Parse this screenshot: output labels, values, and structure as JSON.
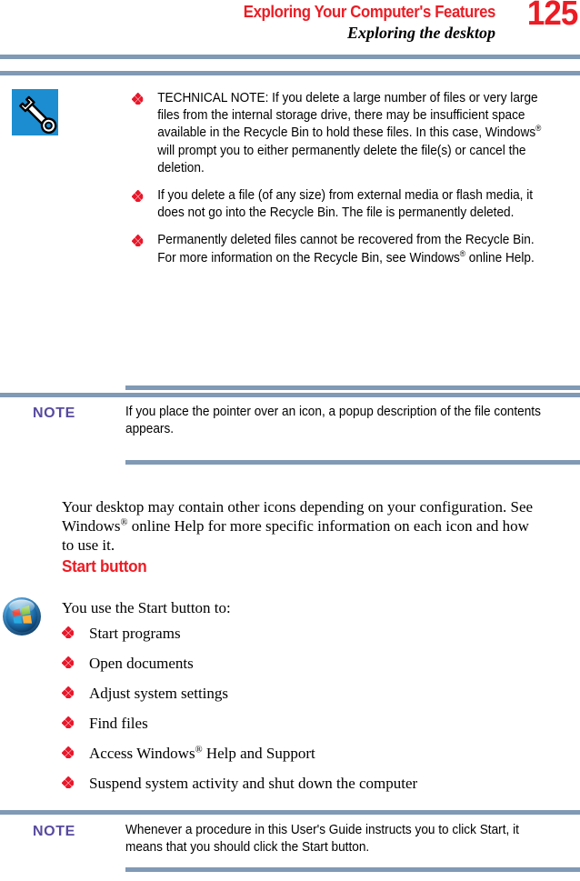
{
  "header": {
    "chapter_title": "Exploring Your Computer's Features",
    "section_title": "Exploring the desktop",
    "page_number": "125"
  },
  "technical_note": {
    "icon": "wrench-icon",
    "bullets": [
      {
        "text_before": "TECHNICAL NOTE: If you delete a large number of files or very large files from the internal storage drive, there may be insufficient space available in the Recycle Bin to hold these files. In this case, Windows",
        "trademark": "®",
        "text_after": " will prompt you to either permanently delete the file(s) or cancel the deletion."
      },
      {
        "text_before": "If you delete a file (of any size) from external media or flash media, it does not go into the Recycle Bin. The file is permanently deleted.",
        "trademark": "",
        "text_after": ""
      },
      {
        "text_before": "Permanently deleted files cannot be recovered from the Recycle Bin.\nFor more information on the Recycle Bin, see Windows",
        "trademark": "®",
        "text_after": " online Help."
      }
    ]
  },
  "note_one": {
    "label": "NOTE",
    "text": "If you place the pointer over an icon, a popup description of the file contents appears."
  },
  "paragraph": {
    "text_before": "Your desktop may contain other icons depending on your configuration. See Windows",
    "trademark": "®",
    "text_after": " online Help for more specific information on each icon and how to use it."
  },
  "start_button_section": {
    "heading": "Start button",
    "icon": "windows-orb-icon",
    "intro": "You use the Start button to:",
    "items": [
      {
        "text_before": "Start programs",
        "trademark": "",
        "text_after": ""
      },
      {
        "text_before": "Open documents",
        "trademark": "",
        "text_after": ""
      },
      {
        "text_before": "Adjust system settings",
        "trademark": "",
        "text_after": ""
      },
      {
        "text_before": "Find files",
        "trademark": "",
        "text_after": ""
      },
      {
        "text_before": "Access Windows",
        "trademark": "®",
        "text_after": " Help and Support"
      },
      {
        "text_before": "Suspend system activity and shut down the computer",
        "trademark": "",
        "text_after": ""
      }
    ]
  },
  "note_two": {
    "label": "NOTE",
    "text": "Whenever a procedure in this User's Guide instructs you to click Start, it means that you should click the Start button."
  },
  "colors": {
    "accent_red": "#ec1c24",
    "rule_blue": "#8099b5",
    "note_purple": "#584a9e",
    "icon_tile_blue": "#1c8dd0"
  }
}
